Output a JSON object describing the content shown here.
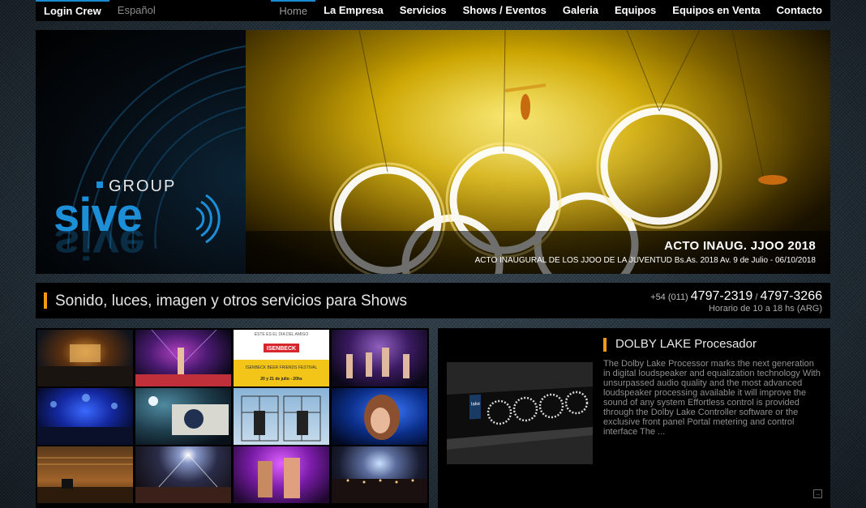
{
  "nav": {
    "left": [
      "Login Crew",
      "Español"
    ],
    "right": [
      "Home",
      "La Empresa",
      "Servicios",
      "Shows / Eventos",
      "Galeria",
      "Equipos",
      "Equipos en Venta",
      "Contacto"
    ]
  },
  "logo": {
    "group": "GROUP",
    "name": "sive"
  },
  "hero": {
    "title": "ACTO INAUG. JJOO 2018",
    "subtitle": "ACTO INAUGURAL DE LOS JJOO DE LA JUVENTUD Bs.As. 2018 Av. 9 de Julio - 06/10/2018"
  },
  "tagline": "Sonido, luces, imagen y otros servicios para Shows",
  "contact": {
    "prefix": "+54 (011)",
    "phone1": "4797-2319",
    "sep": "/",
    "phone2": "4797-3266",
    "hours": "Horario de 10 a 18 hs (ARG)"
  },
  "gallery": {
    "poster": {
      "top": "ESTE ES EL DIA DEL AMIGO",
      "brand": "ISENBECK",
      "fest": "ISENBECK BEER FRIENDS FESTIVAL",
      "dates": "20 y 21 de julio - 20hs"
    }
  },
  "product": {
    "title": "DOLBY LAKE Procesador",
    "description": "The Dolby Lake Processor marks the next generation in digital loudspeaker and equalization technology With unsurpassed audio quality and the most advanced loudspeaker processing available it will improve the sound of any system Effortless control is provided through the Dolby Lake Controller software or the exclusive front panel Portal metering and control interface The ...",
    "device_label": "lake"
  },
  "colors": {
    "accent": "#f29b12",
    "nav_active": "#1a8bd0",
    "logo_blue": "#1c8fd8"
  }
}
